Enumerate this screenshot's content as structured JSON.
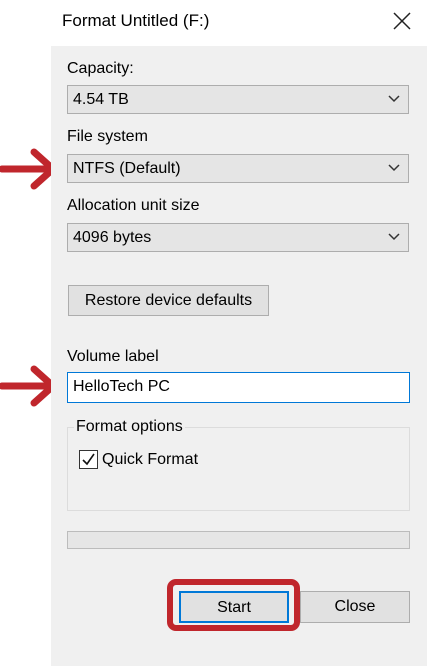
{
  "window": {
    "title": "Format Untitled (F:)"
  },
  "capacity": {
    "label": "Capacity:",
    "value": "4.54 TB"
  },
  "file_system": {
    "label": "File system",
    "value": "NTFS (Default)"
  },
  "allocation": {
    "label": "Allocation unit size",
    "value": "4096 bytes"
  },
  "restore_label": "Restore device defaults",
  "volume": {
    "label": "Volume label",
    "value": "HelloTech PC"
  },
  "format_options": {
    "title": "Format options",
    "quick_format": {
      "label": "Quick Format",
      "checked": true
    }
  },
  "progress": {
    "value": 0
  },
  "buttons": {
    "start": "Start",
    "close": "Close"
  },
  "colors": {
    "annotation": "#c0262c",
    "focus_border": "#0078d7",
    "dialog_bg": "#f0f0f0",
    "progress_fill": "#06b025"
  },
  "icons": {
    "close": "close-icon",
    "dropdown": "chevron-down-icon",
    "check": "checkmark-icon",
    "annotation": "red-arrow-icon"
  }
}
